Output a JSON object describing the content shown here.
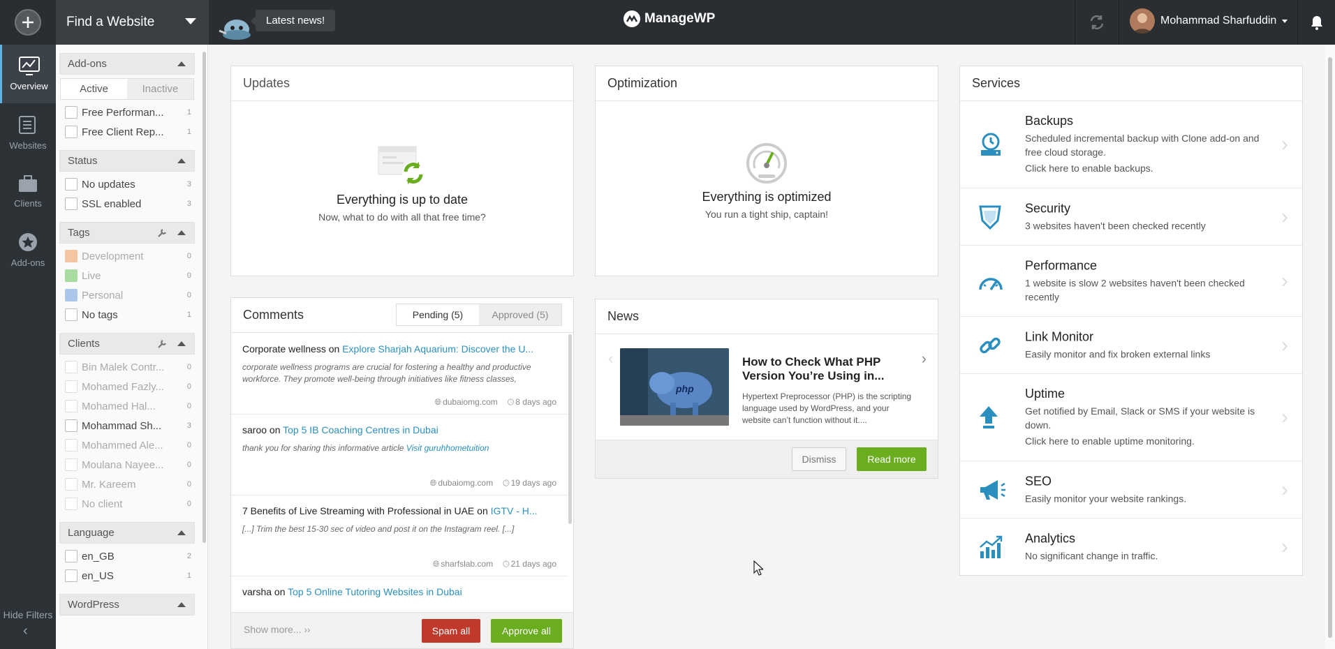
{
  "topbar": {
    "site_label": "Find a Website",
    "news_label": "Latest news!",
    "brand": "ManageWP",
    "user_name": "Mohammad Sharfuddin"
  },
  "nav": {
    "items": [
      {
        "label": "Overview"
      },
      {
        "label": "Websites"
      },
      {
        "label": "Clients"
      },
      {
        "label": "Add-ons"
      }
    ],
    "hide_filters": "Hide Filters"
  },
  "filters": {
    "addons": {
      "title": "Add-ons",
      "tab_active": "Active",
      "tab_inactive": "Inactive",
      "items": [
        {
          "label": "Free Performan...",
          "count": "1"
        },
        {
          "label": "Free Client Rep...",
          "count": "1"
        }
      ]
    },
    "status": {
      "title": "Status",
      "items": [
        {
          "label": "No updates",
          "count": "3"
        },
        {
          "label": "SSL enabled",
          "count": "3"
        }
      ]
    },
    "tags": {
      "title": "Tags",
      "items": [
        {
          "label": "Development",
          "count": "0",
          "color": "#f3c5a0"
        },
        {
          "label": "Live",
          "count": "0",
          "color": "#a8dca0"
        },
        {
          "label": "Personal",
          "count": "0",
          "color": "#a9c7ea"
        },
        {
          "label": "No tags",
          "count": "1"
        }
      ]
    },
    "clients": {
      "title": "Clients",
      "items": [
        {
          "label": "Bin Malek Contr...",
          "count": "0"
        },
        {
          "label": "Mohamed Fazly...",
          "count": "0"
        },
        {
          "label": "Mohamed Hal...",
          "count": "0"
        },
        {
          "label": "Mohammad Sh...",
          "count": "3"
        },
        {
          "label": "Mohammed Ale...",
          "count": "0"
        },
        {
          "label": "Moulana Nayee...",
          "count": "0"
        },
        {
          "label": "Mr. Kareem",
          "count": "0"
        },
        {
          "label": "No client",
          "count": "0"
        }
      ]
    },
    "language": {
      "title": "Language",
      "items": [
        {
          "label": "en_GB",
          "count": "2"
        },
        {
          "label": "en_US",
          "count": "1"
        }
      ]
    },
    "wordpress": {
      "title": "WordPress"
    }
  },
  "updates": {
    "title": "Updates",
    "headline": "Everything is up to date",
    "sub": "Now, what to do with all that free time?"
  },
  "optimization": {
    "title": "Optimization",
    "headline": "Everything is optimized",
    "sub": "You run a tight ship, captain!"
  },
  "comments": {
    "title": "Comments",
    "tab_pending": "Pending (5)",
    "tab_approved": "Approved (5)",
    "items": [
      {
        "author": "Corporate wellness",
        "on": "on",
        "post": "Explore Sharjah Aquarium: Discover the U...",
        "body": "corporate wellness programs are crucial for fostering a healthy and productive workforce. They promote well-being through initiatives like fitness classes,",
        "link": "",
        "site": "dubaiomg.com",
        "time": "8 days ago"
      },
      {
        "author": "saroo",
        "on": "on",
        "post": "Top 5 IB Coaching Centres in Dubai",
        "body": "thank you for sharing this informative article",
        "link": "Visit guruhhometuition",
        "site": "dubaiomg.com",
        "time": "19 days ago"
      },
      {
        "author": "7 Benefits of Live Streaming with Professional in UAE",
        "on": "on",
        "post": "IGTV - H...",
        "body": "[...] Trim the best 15-30 sec of video and post it on the Instagram reel. [...]",
        "link": "",
        "site": "sharfslab.com",
        "time": "21 days ago"
      },
      {
        "author": "varsha",
        "on": "on",
        "post": "Top 5 Online Tutoring Websites in Dubai",
        "body": "",
        "link": "",
        "site": "",
        "time": ""
      }
    ],
    "show_more": "Show more...",
    "spam_all": "Spam all",
    "approve_all": "Approve all"
  },
  "news": {
    "title": "News",
    "headline": "How to Check What PHP Version You’re Using in...",
    "body": "Hypertext Preprocessor (PHP) is the scripting language used by WordPress, and your website can’t function without it....",
    "dismiss": "Dismiss",
    "read_more": "Read more",
    "image_text": "php"
  },
  "services": {
    "title": "Services",
    "items": [
      {
        "name": "Backups",
        "desc": "Scheduled incremental backup with Clone add-on and free cloud storage.",
        "desc2": "Click here to enable backups.",
        "icon": "backup-icon"
      },
      {
        "name": "Security",
        "desc": "3 websites haven't been checked recently",
        "desc2": "",
        "icon": "shield-icon"
      },
      {
        "name": "Performance",
        "desc": "1 website is slow 2 websites haven't been checked recently",
        "desc2": "",
        "icon": "speedometer-icon"
      },
      {
        "name": "Link Monitor",
        "desc": "Easily monitor and fix broken external links",
        "desc2": "",
        "icon": "link-icon"
      },
      {
        "name": "Uptime",
        "desc": "Get notified by Email, Slack or SMS if your website is down.",
        "desc2": "Click here to enable uptime monitoring.",
        "icon": "upload-arrow-icon"
      },
      {
        "name": "SEO",
        "desc": "Easily monitor your website rankings.",
        "desc2": "",
        "icon": "megaphone-icon"
      },
      {
        "name": "Analytics",
        "desc": "No significant change in traffic.",
        "desc2": "",
        "icon": "chart-icon"
      }
    ]
  },
  "colors": {
    "accent": "#2a8fbf",
    "green": "#6aad1e",
    "red": "#c0392b",
    "dark": "#2a2d31"
  }
}
